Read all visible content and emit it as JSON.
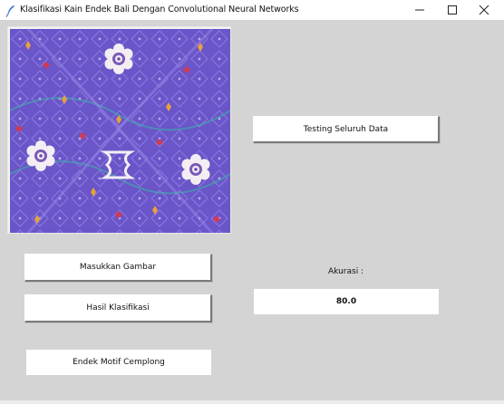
{
  "window": {
    "title": "Klasifikasi Kain Endek Bali Dengan Convolutional Neural Networks",
    "app_icon": "feather-icon",
    "controls": [
      "minimize-icon",
      "maximize-icon",
      "close-icon"
    ]
  },
  "image_panel": {
    "content": "endek-fabric-image",
    "colors": {
      "base": "#6a55c9",
      "flower": "#f4eef4",
      "accent_orange": "#e8a23a",
      "accent_red": "#d23a52",
      "accent_teal": "#3ab8a8"
    }
  },
  "buttons": {
    "testing_all": "Testing Seluruh Data",
    "load_image": "Masukkan Gambar",
    "classify": "Hasil Klasifikasi"
  },
  "accuracy": {
    "label": "Akurasi :",
    "value": "80.0"
  },
  "result": {
    "text": "Endek Motif Cemplong"
  },
  "colors": {
    "window_bg": "#d4d4d4",
    "button_bg": "#ffffff"
  }
}
